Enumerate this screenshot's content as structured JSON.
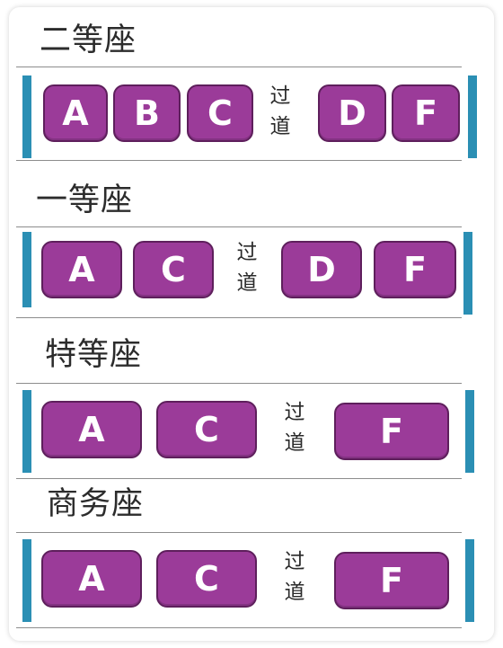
{
  "aisle": [
    "过",
    "道"
  ],
  "sections": [
    {
      "title": "二等座",
      "left_seats": [
        "A",
        "B",
        "C"
      ],
      "right_seats": [
        "D",
        "F"
      ]
    },
    {
      "title": "一等座",
      "left_seats": [
        "A",
        "C"
      ],
      "right_seats": [
        "D",
        "F"
      ]
    },
    {
      "title": "特等座",
      "left_seats": [
        "A",
        "C"
      ],
      "right_seats": [
        "F"
      ]
    },
    {
      "title": "商务座",
      "left_seats": [
        "A",
        "C"
      ],
      "right_seats": [
        "F"
      ]
    }
  ],
  "colors": {
    "seat": "#9b3b99",
    "seat_border": "#5e1f5c",
    "edge_bar": "#2b8fb4",
    "divider": "#8d8d8d"
  }
}
